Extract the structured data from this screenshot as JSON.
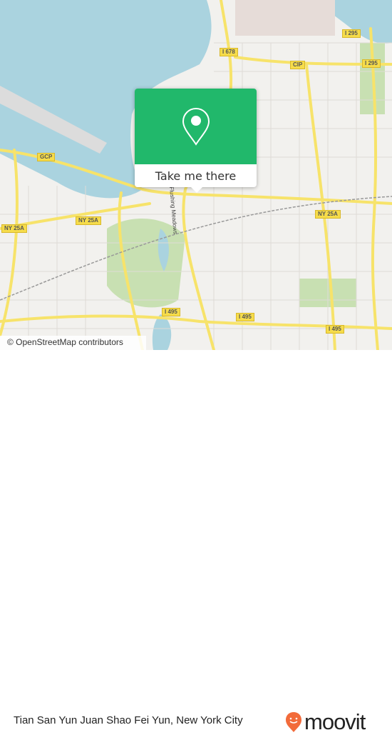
{
  "map": {
    "attribution": "© OpenStreetMap contributors",
    "road_labels": [
      "I 295",
      "I 678",
      "CIP",
      "I 295",
      "GCP",
      "NY 25A",
      "NY 25A",
      "NY 25A",
      "I 495",
      "I 495",
      "I 495",
      "Flushing Meadows"
    ],
    "colors": {
      "water": "#aad3df",
      "road": "#f7e36a",
      "park": "#c8e0b2",
      "land": "#f2f1ee"
    }
  },
  "popup": {
    "cta_label": "Take me there",
    "icon": "map-pin-icon",
    "color": "#21b86b"
  },
  "footer": {
    "place_name": "Tian San Yun Juan Shao Fei Yun, New York City",
    "logo_text": "moovit",
    "logo_icon": "moovit-pin-icon",
    "logo_color": "#f26b3a"
  }
}
